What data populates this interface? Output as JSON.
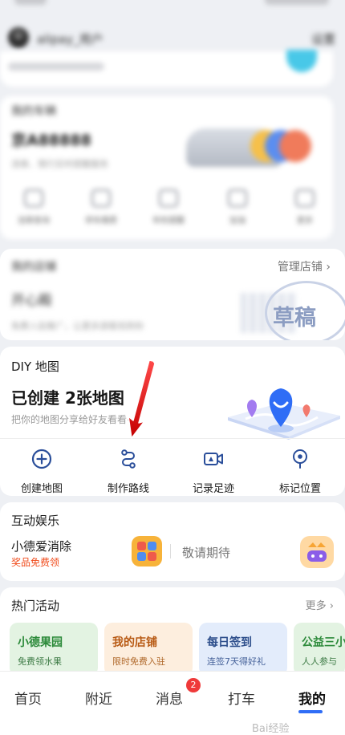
{
  "diy": {
    "title": "DIY 地图",
    "count_text": "已创建 2张地图",
    "subtitle": "把你的地图分享给好友看看~",
    "actions": [
      {
        "label": "创建地图",
        "icon": "plus-circle-icon"
      },
      {
        "label": "制作路线",
        "icon": "route-icon"
      },
      {
        "label": "记录足迹",
        "icon": "video-camera-icon"
      },
      {
        "label": "标记位置",
        "icon": "location-pin-icon"
      }
    ]
  },
  "shop": {
    "manage_label": "管理店铺",
    "stamp_text": "草稿"
  },
  "entertainment": {
    "title": "互动娱乐",
    "game_name": "小德爱消除",
    "game_prize": "奖品免费领",
    "coming_soon": "敬请期待"
  },
  "hot": {
    "title": "热门活动",
    "more_label": "更多",
    "tiles": [
      {
        "title": "小德果园",
        "subtitle": "免费领水果",
        "bg": "#e3f3e2",
        "title_color": "#2c8a3a",
        "sub_color": "#3c7a44"
      },
      {
        "title": "我的店铺",
        "subtitle": "限时免费入驻",
        "bg": "#fdeede",
        "title_color": "#b85a14",
        "sub_color": "#b0682a"
      },
      {
        "title": "每日签到",
        "subtitle": "连签7天得好礼",
        "bg": "#e3ecfb",
        "title_color": "#2e4f8c",
        "sub_color": "#46629a"
      },
      {
        "title": "公益三小",
        "subtitle": "人人参与",
        "bg": "#e3f3e2",
        "title_color": "#2c8a3a",
        "sub_color": "#3c7a44"
      }
    ]
  },
  "nav": {
    "items": [
      {
        "label": "首页"
      },
      {
        "label": "附近"
      },
      {
        "label": "消息"
      },
      {
        "label": "打车"
      },
      {
        "label": "我的"
      }
    ],
    "message_badge": "2",
    "active": "我的",
    "accent": "#2f6df6"
  },
  "watermark": "Bai经验",
  "colors": {
    "icon_blue": "#2a4e9a",
    "arrow_red": "#e60000",
    "prize_red": "#f04a1a"
  }
}
